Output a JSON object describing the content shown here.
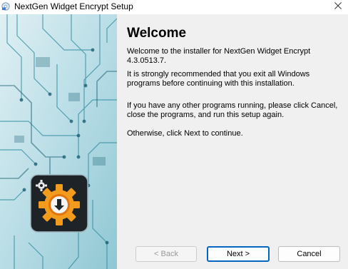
{
  "window": {
    "title": "NextGen Widget Encrypt Setup"
  },
  "main": {
    "heading": "Welcome",
    "paragraphs": [
      "Welcome to the installer for NextGen Widget Encrypt 4.3.0513.7.",
      "It is strongly recommended that you exit all Windows programs before continuing with this installation.",
      "If you have any other programs running, please click Cancel, close the programs, and run this setup again.",
      "Otherwise, click Next to continue."
    ]
  },
  "buttons": {
    "back": "< Back",
    "next": "Next >",
    "cancel": "Cancel"
  },
  "icons": {
    "app": "installer-disc-icon",
    "close": "close-icon",
    "banner": "gear-download-icon"
  },
  "colors": {
    "accent": "#0067c0",
    "gear": "#f5a623",
    "panel": "#cfe6ee"
  }
}
